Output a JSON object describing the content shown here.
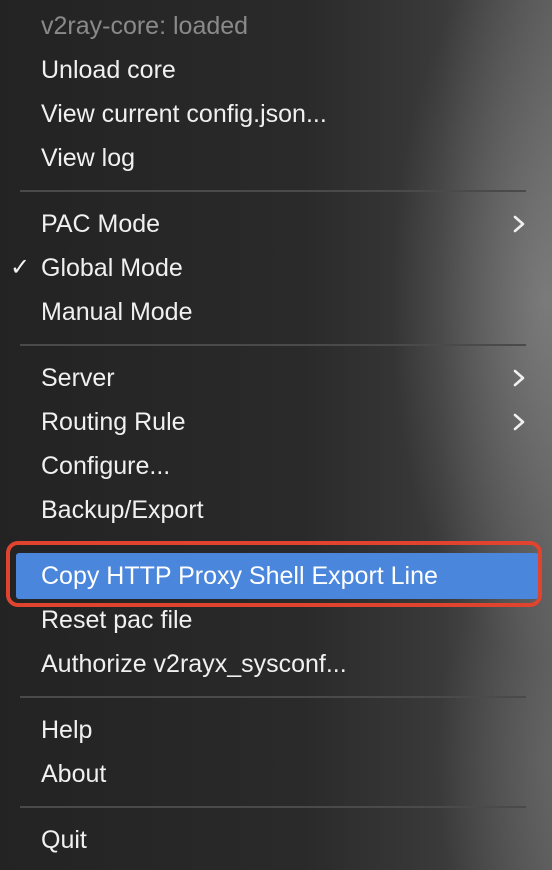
{
  "menu": {
    "status": "v2ray-core: loaded",
    "unload": "Unload core",
    "view_config": "View current config.json...",
    "view_log": "View log",
    "pac_mode": "PAC Mode",
    "global_mode": "Global Mode",
    "global_mode_checked": true,
    "checkmark": "✓",
    "manual_mode": "Manual Mode",
    "server": "Server",
    "routing_rule": "Routing Rule",
    "configure": "Configure...",
    "backup_export": "Backup/Export",
    "copy_proxy": "Copy HTTP Proxy Shell Export Line",
    "reset_pac": "Reset pac file",
    "authorize": "Authorize v2rayx_sysconf...",
    "help": "Help",
    "about": "About",
    "quit": "Quit"
  },
  "colors": {
    "highlight": "#4a86dc",
    "annotation_box": "#e0442f",
    "text": "#f0f0f0",
    "disabled_text": "#8a8a8a"
  },
  "icons": {
    "submenu": "chevron-right-icon",
    "checked": "checkmark-icon"
  }
}
